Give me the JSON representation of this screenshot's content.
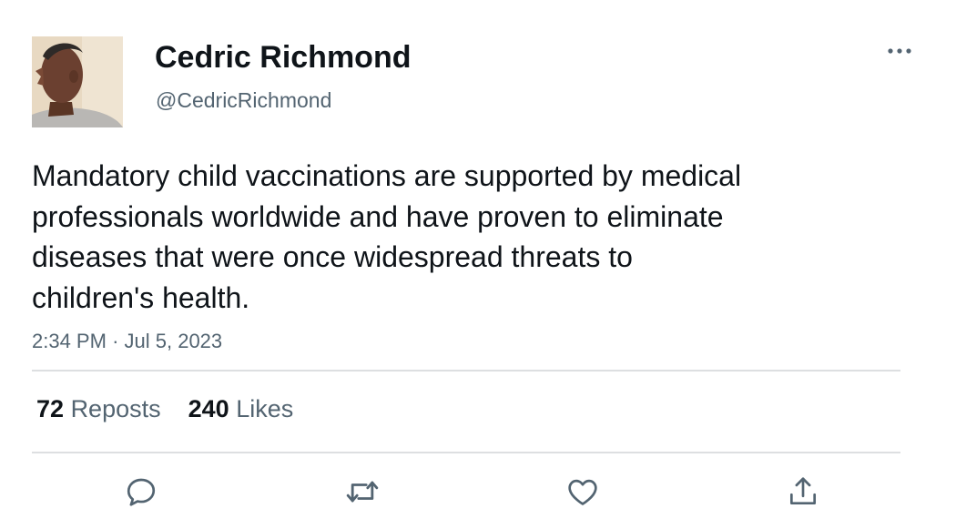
{
  "author": {
    "display_name": "Cedric Richmond",
    "handle": "@CedricRichmond"
  },
  "tweet": {
    "text": "Mandatory child vaccinations are supported by medical\nprofessionals worldwide and have proven to eliminate\ndiseases that were once widespread threats to\nchildren's health.",
    "time": "2:34 PM",
    "separator": "·",
    "date": "Jul 5, 2023"
  },
  "stats": {
    "reposts_count": "72",
    "reposts_label": "Reposts",
    "likes_count": "240",
    "likes_label": "Likes"
  },
  "actions": [
    "reply-icon",
    "repost-icon",
    "like-icon",
    "share-icon"
  ],
  "colors": {
    "text_primary": "#0f1419",
    "text_secondary": "#536471",
    "divider": "#dddfe1"
  }
}
